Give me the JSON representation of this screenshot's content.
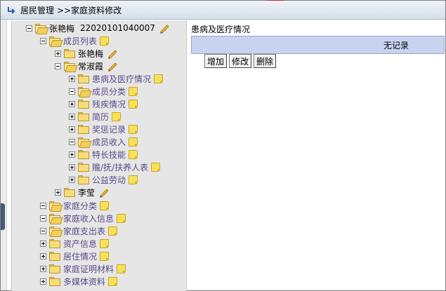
{
  "header": {
    "title": "居民管理",
    "breadcrumb": ">>家庭资料修改"
  },
  "tree": {
    "root": {
      "name": "张艳梅",
      "id": "22020101040007"
    },
    "members_folder": "成员列表",
    "members": [
      {
        "name": "张艳梅"
      },
      {
        "name": "常淑霞",
        "children": [
          "患病及医疗情况",
          "成员分类",
          "残疾情况",
          "简历",
          "奖惩记录",
          "成员收入",
          "特长技能",
          "赡/抚/扶养人表",
          "公益劳动"
        ]
      },
      {
        "name": "李莹"
      }
    ],
    "family_items": [
      "家庭分类",
      "家庭收入信息",
      "家庭支出表",
      "资产信息",
      "居住情况",
      "家庭证明材料",
      "多媒体资料"
    ]
  },
  "content": {
    "section_title": "患病及医疗情况",
    "empty_text": "无记录",
    "buttons": {
      "add": "增加",
      "edit": "修改",
      "delete": "删除"
    }
  },
  "colors": {
    "header_bg": "#d6e0ea",
    "tree_bg": "#e6e6e6",
    "table_header_bg": "#c7d3ef",
    "link_text": "#5a4a8a"
  }
}
